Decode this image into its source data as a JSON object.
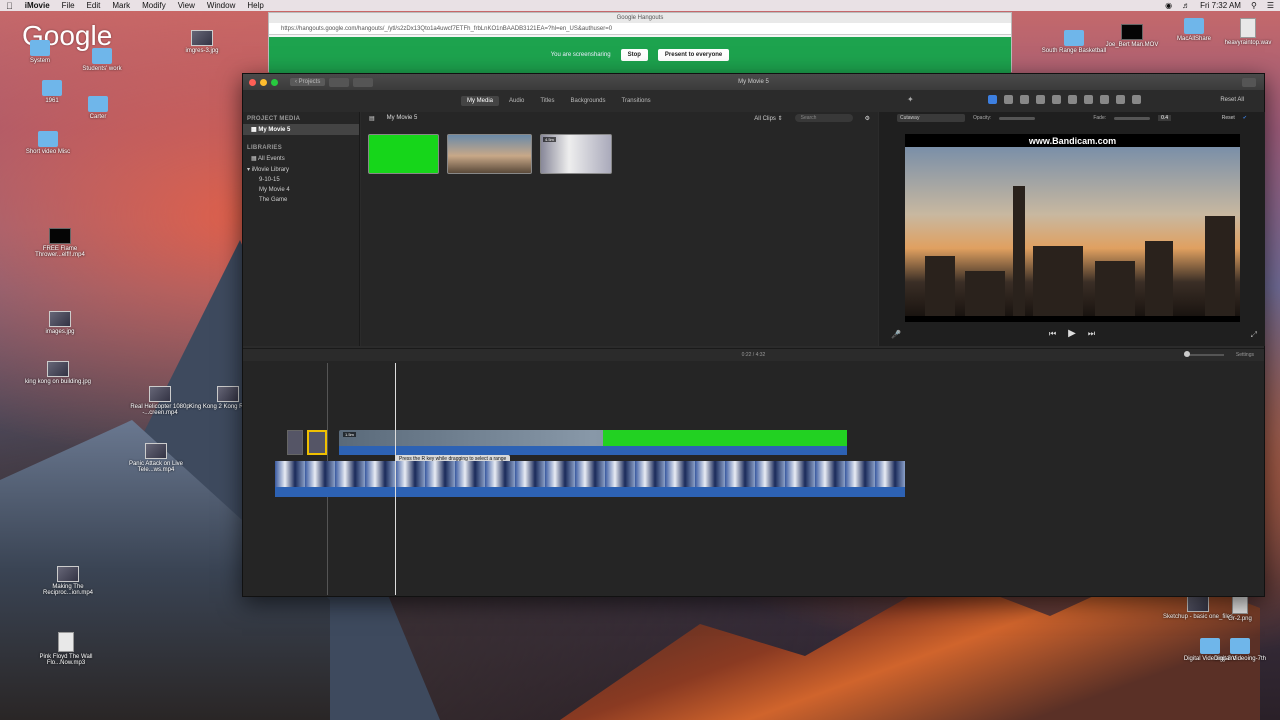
{
  "menubar": {
    "apple": "",
    "app": "iMovie",
    "menus": [
      "File",
      "Edit",
      "Mark",
      "Modify",
      "View",
      "Window",
      "Help"
    ],
    "clock": "Fri 7:32 AM"
  },
  "desktop": {
    "google_logo": "Google",
    "icons": [
      {
        "label": "System"
      },
      {
        "label": "Students' work"
      },
      {
        "label": "imgres-3.jpg"
      },
      {
        "label": "1961"
      },
      {
        "label": "Carter"
      },
      {
        "label": "Short video Misc"
      },
      {
        "label": "FREE Flame Thrower...elf!!.mp4"
      },
      {
        "label": "images.jpg"
      },
      {
        "label": "king kong on building.jpg"
      },
      {
        "label": "Real Helicopter 1080p -...creen.mp4"
      },
      {
        "label": "King Kong 2 Kong Re...t.mp4"
      },
      {
        "label": "Panic Attack on Live Tele...ws.mp4"
      },
      {
        "label": "Making The Reciproc...ion.mp4"
      },
      {
        "label": "Pink Floyd The Wall Flo...Now.mp3"
      },
      {
        "label": "Joe_Bert Man.MOV"
      },
      {
        "label": "MacAllShare"
      },
      {
        "label": "heavyraintop.wav"
      },
      {
        "label": "South Range Basketball"
      },
      {
        "label": "Sketchup - basic one_files"
      },
      {
        "label": "Gr-2.png"
      },
      {
        "label": "Digital Videoing-3rd"
      },
      {
        "label": "Digital Videoing-7th"
      }
    ]
  },
  "hangouts": {
    "window_title": "Google Hangouts",
    "url": "https://hangouts.google.com/hangouts/_/ytl/s2zDx13Qto1a4uwcf7ETFh_frbLnKO1nBAADB3121EA=?hl=en_US&authuser=0",
    "share_text": "You are screensharing",
    "stop_label": "Stop",
    "present_label": "Present to everyone"
  },
  "imovie": {
    "window_title": "My Movie 5",
    "projects_label": "Projects",
    "tabs": [
      "My Media",
      "Audio",
      "Titles",
      "Backgrounds",
      "Transitions"
    ],
    "active_tab": "My Media",
    "reset_all": "Reset All",
    "sidebar": {
      "project_media_header": "PROJECT MEDIA",
      "project": "My Movie 5",
      "libraries_header": "LIBRARIES",
      "all_events": "All Events",
      "movie_library": "iMovie Library",
      "events": [
        "9-10-15",
        "My Movie 4",
        "The Game"
      ]
    },
    "browser": {
      "title": "My Movie 5",
      "filter": "All Clips",
      "search_placeholder": "Search",
      "clip_duration": "4.5m"
    },
    "viewer": {
      "overlay_mode": "Cutaway",
      "opacity_label": "Opacity:",
      "fade_label": "Fade:",
      "fade_value": "0.4",
      "reset_label": "Reset",
      "watermark": "www.Bandicam.com"
    },
    "timebar": {
      "time": "0:22 / 4:32",
      "settings": "Settings"
    },
    "timeline": {
      "tooltip": "Press the R key while dragging to select a range",
      "overlay_duration": "1.5m"
    }
  }
}
